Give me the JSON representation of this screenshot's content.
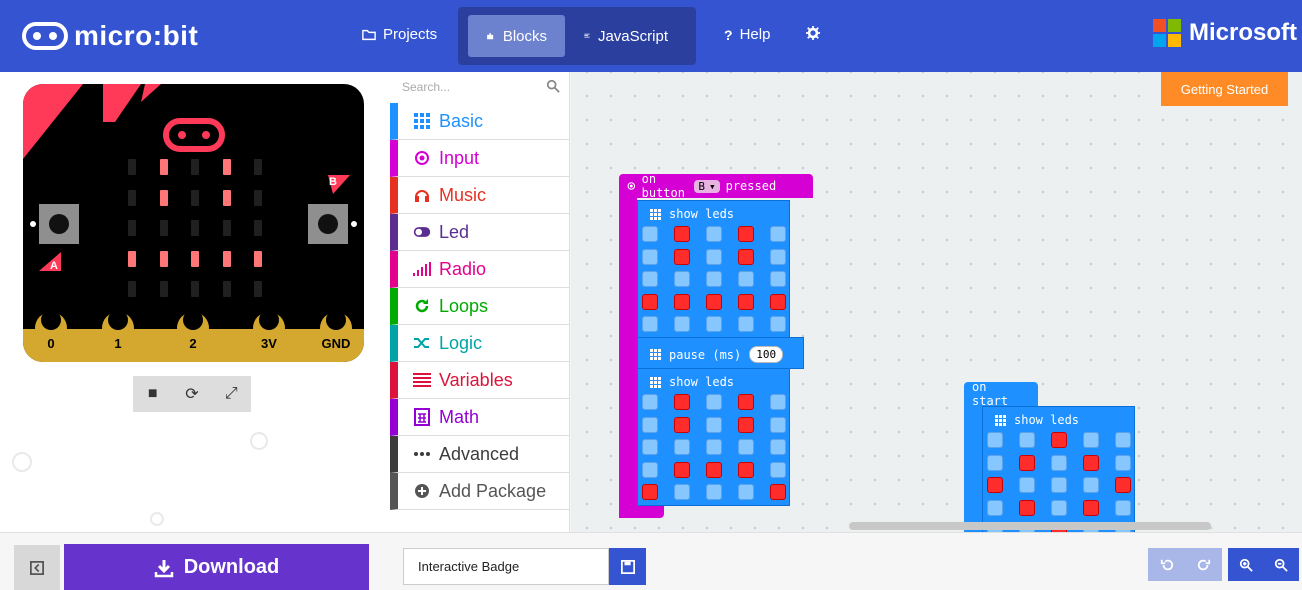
{
  "header": {
    "brand": "micro:bit",
    "nav_projects": "Projects",
    "nav_blocks": "Blocks",
    "nav_javascript": "JavaScript",
    "nav_help": "Help",
    "ms_brand": "Microsoft"
  },
  "simulator": {
    "button_a": "A",
    "button_b": "B",
    "pins": [
      "0",
      "1",
      "2",
      "3V",
      "GND"
    ],
    "led_matrix": [
      [
        0,
        1,
        0,
        1,
        0
      ],
      [
        0,
        1,
        0,
        1,
        0
      ],
      [
        0,
        0,
        0,
        0,
        0
      ],
      [
        1,
        1,
        1,
        1,
        1
      ],
      [
        0,
        0,
        0,
        0,
        0
      ]
    ]
  },
  "toolbox": {
    "search_placeholder": "Search...",
    "categories": [
      {
        "label": "Basic",
        "color": "#1e90ff"
      },
      {
        "label": "Input",
        "color": "#d400d4"
      },
      {
        "label": "Music",
        "color": "#e63022"
      },
      {
        "label": "Led",
        "color": "#5c2d91"
      },
      {
        "label": "Radio",
        "color": "#e3008c"
      },
      {
        "label": "Loops",
        "color": "#00aa00"
      },
      {
        "label": "Logic",
        "color": "#00a4a6"
      },
      {
        "label": "Variables",
        "color": "#dc143c"
      },
      {
        "label": "Math",
        "color": "#9400d3"
      },
      {
        "label": "Advanced",
        "color": "#3c3c3c"
      },
      {
        "label": "Add Package",
        "color": "#555555"
      }
    ]
  },
  "workspace": {
    "getting_started": "Getting Started",
    "event_block": {
      "prefix": "on button",
      "button_value": "B",
      "suffix": "pressed",
      "show_leds_label": "show leds",
      "leds_1": [
        [
          0,
          1,
          0,
          1,
          0
        ],
        [
          0,
          1,
          0,
          1,
          0
        ],
        [
          0,
          0,
          0,
          0,
          0
        ],
        [
          1,
          1,
          1,
          1,
          1
        ],
        [
          0,
          0,
          0,
          0,
          0
        ]
      ],
      "pause_label": "pause (ms)",
      "pause_value": "100",
      "leds_2": [
        [
          0,
          1,
          0,
          1,
          0
        ],
        [
          0,
          1,
          0,
          1,
          0
        ],
        [
          0,
          0,
          0,
          0,
          0
        ],
        [
          0,
          1,
          1,
          1,
          0
        ],
        [
          1,
          0,
          0,
          0,
          1
        ]
      ]
    },
    "start_block": {
      "label": "on start",
      "show_leds_label": "show leds",
      "leds": [
        [
          0,
          0,
          1,
          0,
          0
        ],
        [
          0,
          1,
          0,
          1,
          0
        ],
        [
          1,
          0,
          0,
          0,
          1
        ],
        [
          0,
          1,
          0,
          1,
          0
        ],
        [
          0,
          0,
          1,
          0,
          0
        ]
      ]
    }
  },
  "footer": {
    "download": "Download",
    "project_name": "Interactive Badge"
  }
}
